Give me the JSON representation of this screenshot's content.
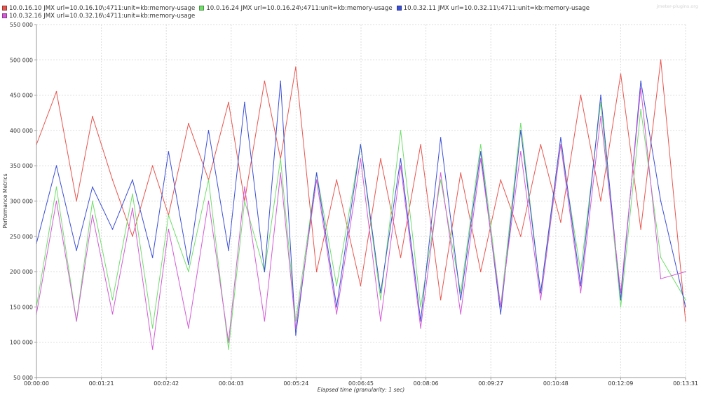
{
  "watermark": "jmeter-plugins.org",
  "chart_data": {
    "type": "line",
    "title": "",
    "xlabel": "Elapsed time (granularity: 1 sec)",
    "ylabel": "Performance Metrics",
    "ylim": [
      50000,
      550000
    ],
    "xlim_seconds": [
      0,
      811
    ],
    "grid": true,
    "legend_position": "top-left",
    "y_ticks": [
      "50 000",
      "100 000",
      "150 000",
      "200 000",
      "250 000",
      "300 000",
      "350 000",
      "400 000",
      "450 000",
      "500 000",
      "550 000"
    ],
    "x_ticks": [
      "00:00:00",
      "00:01:21",
      "00:02:42",
      "00:04:03",
      "00:05:24",
      "00:06:45",
      "00:08:06",
      "00:09:27",
      "00:10:48",
      "00:12:09",
      "00:13:31"
    ],
    "x": [
      "00:00:00",
      "00:00:25",
      "00:00:50",
      "00:01:10",
      "00:01:35",
      "00:02:00",
      "00:02:25",
      "00:02:45",
      "00:03:10",
      "00:03:35",
      "00:04:00",
      "00:04:20",
      "00:04:45",
      "00:05:05",
      "00:05:24",
      "00:05:50",
      "00:06:15",
      "00:06:45",
      "00:07:10",
      "00:07:35",
      "00:08:00",
      "00:08:25",
      "00:08:50",
      "00:09:15",
      "00:09:40",
      "00:10:05",
      "00:10:30",
      "00:10:55",
      "00:11:20",
      "00:11:45",
      "00:12:10",
      "00:12:35",
      "00:13:00",
      "00:13:31"
    ],
    "series": [
      {
        "name": "10.0.16.10 JMX url=10.0.16.10\\:4711:unit=kb:memory-usage",
        "color": "#e8554e",
        "values": [
          380000,
          455000,
          300000,
          420000,
          330000,
          250000,
          350000,
          280000,
          410000,
          330000,
          440000,
          300000,
          470000,
          360000,
          490000,
          200000,
          330000,
          180000,
          360000,
          220000,
          380000,
          160000,
          340000,
          200000,
          330000,
          250000,
          380000,
          270000,
          450000,
          300000,
          480000,
          260000,
          500000,
          130000
        ]
      },
      {
        "name": "10.0.16.24 JMX url=10.0.16.24\\:4711:unit=kb:memory-usage",
        "color": "#6fde6a",
        "values": [
          150000,
          320000,
          130000,
          300000,
          160000,
          310000,
          120000,
          280000,
          200000,
          330000,
          90000,
          300000,
          200000,
          360000,
          130000,
          340000,
          180000,
          380000,
          160000,
          400000,
          150000,
          330000,
          170000,
          380000,
          150000,
          410000,
          170000,
          380000,
          200000,
          440000,
          150000,
          430000,
          220000,
          160000
        ]
      },
      {
        "name": "10.0.32.11 JMX url=10.0.32.11\\:4711:unit=kb:memory-usage",
        "color": "#3b4fd6",
        "values": [
          240000,
          350000,
          230000,
          320000,
          260000,
          330000,
          220000,
          370000,
          210000,
          400000,
          230000,
          440000,
          200000,
          470000,
          110000,
          340000,
          150000,
          380000,
          170000,
          360000,
          130000,
          390000,
          160000,
          370000,
          140000,
          400000,
          170000,
          390000,
          180000,
          450000,
          160000,
          470000,
          300000,
          150000
        ]
      },
      {
        "name": "10.0.32.16 JMX url=10.0.32.16\\:4711:unit=kb:memory-usage",
        "color": "#d45ad8",
        "values": [
          140000,
          300000,
          130000,
          280000,
          140000,
          290000,
          90000,
          260000,
          120000,
          300000,
          100000,
          320000,
          130000,
          340000,
          120000,
          330000,
          140000,
          360000,
          130000,
          350000,
          120000,
          340000,
          140000,
          360000,
          150000,
          370000,
          160000,
          380000,
          170000,
          420000,
          170000,
          460000,
          190000,
          200000
        ]
      }
    ]
  }
}
